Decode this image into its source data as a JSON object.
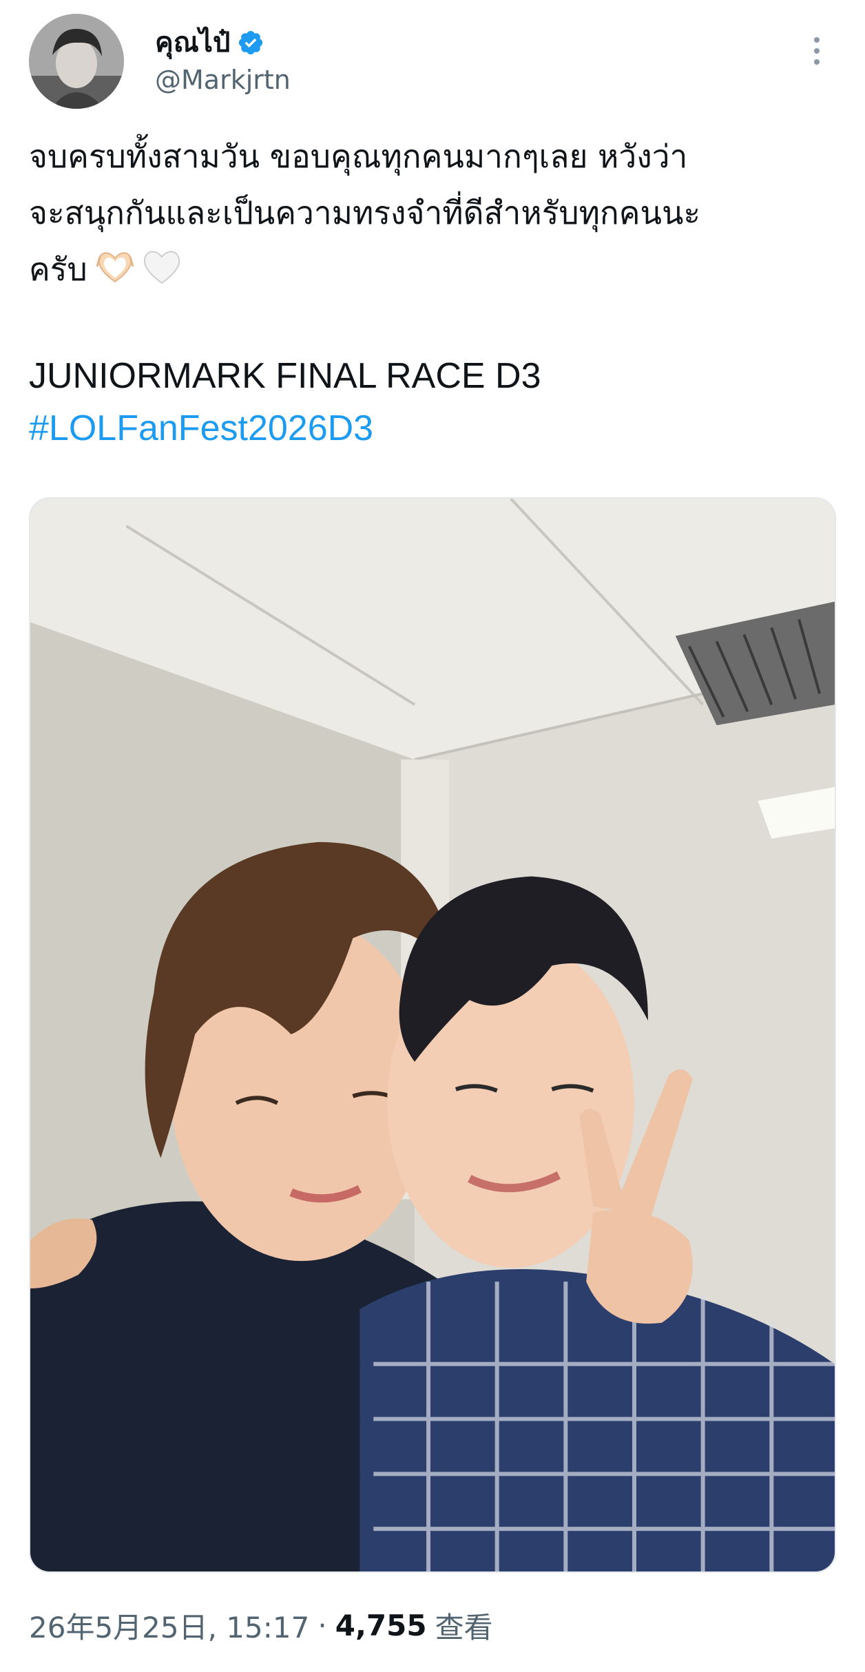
{
  "tweet": {
    "author": {
      "display_name": "คุณไป๋",
      "handle": "@Markjrtn",
      "verified": true,
      "avatar_icon": "user-avatar"
    },
    "more_icon": "more-vertical-icon",
    "text": "จบครบทั้งสามวัน ขอบคุณทุกคนมากๆเลย หวังว่า\nจะสนุกกันและเป็นความทรงจำที่ดีสำหรับทุกคนนะ\nครับ",
    "emojis": [
      "heart-hands-emoji",
      "white-heart-emoji"
    ],
    "title_line": "JUNIORMARK FINAL RACE D3",
    "hashtag": "#LOLFanFest2026D3",
    "photo": {
      "alt_icon": "selfie-photo"
    },
    "timestamp": "26年5月25日, 15:17",
    "separator": "·",
    "views_count": "4,755",
    "views_label": "查看"
  },
  "colors": {
    "link": "#1d9bf0",
    "secondary_text": "#536471",
    "primary_text": "#0f1419",
    "verified_badge": "#1d9bf0"
  }
}
